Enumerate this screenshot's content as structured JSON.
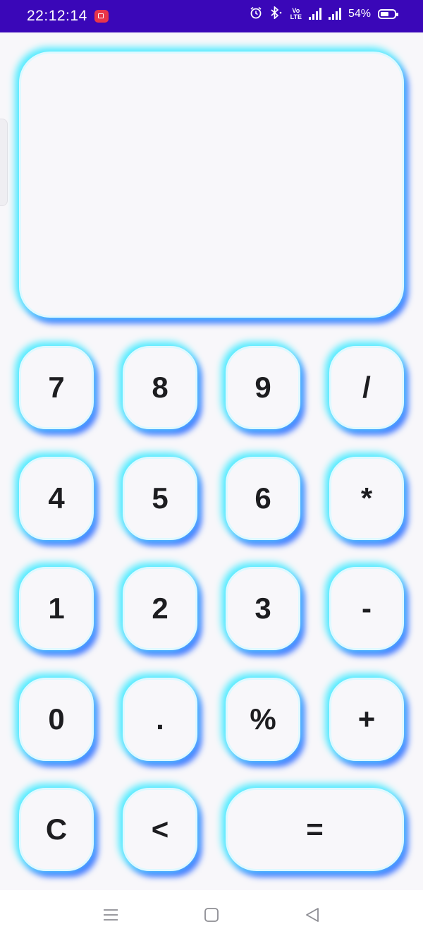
{
  "status_bar": {
    "time": "22:12:14",
    "battery": "54%",
    "icons": [
      "screen-record-icon",
      "alarm-icon",
      "bluetooth-icon",
      "volte-icon",
      "signal-icon",
      "signal-icon",
      "battery-icon"
    ],
    "volte_top": "Vo",
    "volte_bottom": "LTE"
  },
  "display": {
    "value": ""
  },
  "keypad": {
    "k7": "7",
    "k8": "8",
    "k9": "9",
    "div": "/",
    "k4": "4",
    "k5": "5",
    "k6": "6",
    "mul": "*",
    "k1": "1",
    "k2": "2",
    "k3": "3",
    "sub": "-",
    "k0": "0",
    "dot": ".",
    "pct": "%",
    "add": "+",
    "clear": "C",
    "back": "<",
    "equals": "="
  },
  "nav_bar": {
    "icons": [
      "menu-icon",
      "home-icon",
      "back-icon"
    ]
  },
  "colors": {
    "status_bar": "#3a07b8",
    "glow_cyan": "#55ecff",
    "glow_blue": "#3f74ff",
    "background": "#f8f7fa"
  }
}
